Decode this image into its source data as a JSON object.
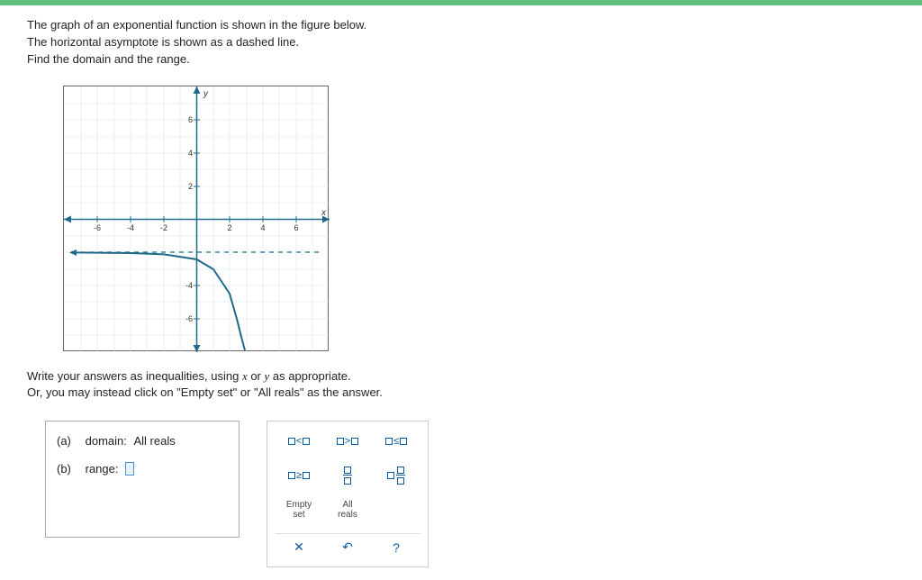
{
  "problem": {
    "line1": "The graph of an exponential function is shown in the figure below.",
    "line2": "The horizontal asymptote is shown as a dashed line.",
    "line3": "Find the domain and the range."
  },
  "instructions": {
    "line1_a": "Write your answers as inequalities, using ",
    "line1_b": " or ",
    "line1_c": " as appropriate.",
    "line2": "Or, you may instead click on \"Empty set\" or \"All reals\" as the answer.",
    "var_x": "x",
    "var_y": "y"
  },
  "answers": {
    "a_label": "(a)",
    "a_field": "domain:",
    "a_value": "All reals",
    "b_label": "(b)",
    "b_field": "range:",
    "b_value": ""
  },
  "keypad": {
    "lt": "<",
    "gt": ">",
    "le": "≤",
    "ge": "≥",
    "empty_set_l1": "Empty",
    "empty_set_l2": "set",
    "all_reals_l1": "All",
    "all_reals_l2": "reals",
    "clear": "✕",
    "undo": "↶",
    "help": "?"
  },
  "chart_data": {
    "type": "line",
    "title": "",
    "xlabel": "x",
    "ylabel": "y",
    "xlim": [
      -8,
      8
    ],
    "ylim": [
      -8,
      8
    ],
    "xticks": [
      -6,
      -4,
      -2,
      2,
      4,
      6
    ],
    "yticks": [
      -6,
      -4,
      2,
      4,
      6
    ],
    "asymptote_y": -2,
    "series": [
      {
        "name": "exponential curve",
        "x": [
          -8,
          -6,
          -4,
          -2,
          0,
          1,
          2,
          2.4,
          2.7,
          3
        ],
        "y": [
          -2.0,
          -2.0,
          -2.02,
          -2.1,
          -2.4,
          -3.0,
          -4.5,
          -6.0,
          -7.2,
          -8.0
        ]
      }
    ]
  }
}
